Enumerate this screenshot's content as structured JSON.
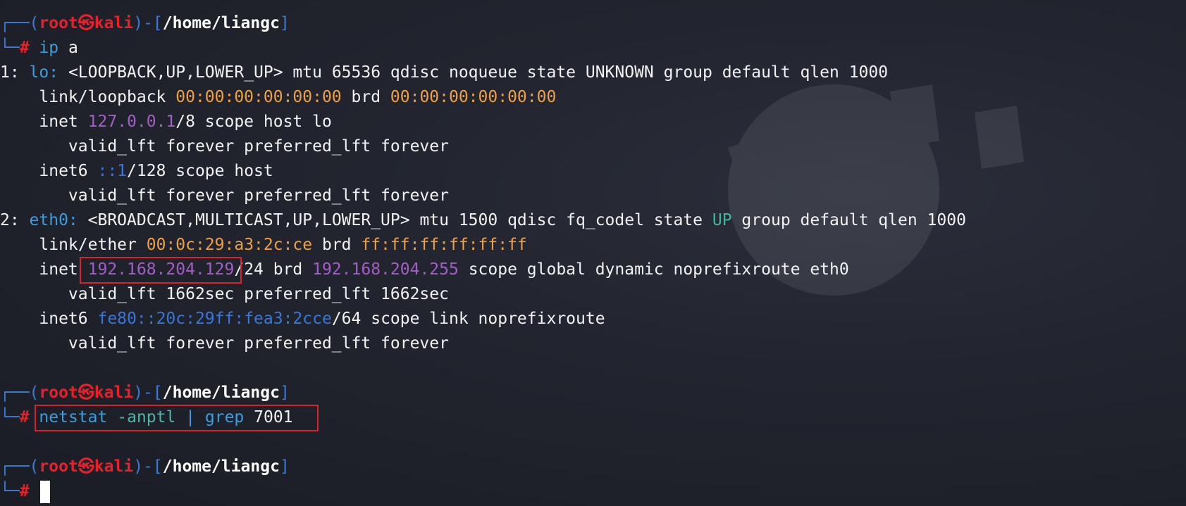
{
  "prompt": {
    "frame_top": "┌──",
    "frame_bottom": "└─",
    "open_paren": "(",
    "user": "root",
    "at_symbol": "㉿",
    "host": "kali",
    "close_paren": ")",
    "dash": "-",
    "open_bracket": "[",
    "path": "/home/liangc",
    "close_bracket": "]",
    "hash": "#"
  },
  "commands": {
    "first": {
      "name": "ip",
      "args": "a"
    },
    "second": {
      "name": "netstat",
      "flag": "-anptl",
      "pipe": "|",
      "grep": "grep",
      "pattern": "7001"
    }
  },
  "output": {
    "lo_index": "1: ",
    "lo_name": "lo:",
    "lo_flags": " <LOOPBACK,UP,LOWER_UP> mtu 65536 qdisc noqueue state UNKNOWN group default qlen 1000",
    "lo_link_label": "    link/loopback ",
    "lo_mac": "00:00:00:00:00:00",
    "lo_brd_label": " brd ",
    "lo_brd": "00:00:00:00:00:00",
    "lo_inet_label": "    inet ",
    "lo_ip": "127.0.0.1",
    "lo_inet_rest": "/8 scope host lo",
    "lo_valid1": "       valid_lft forever preferred_lft forever",
    "lo_inet6_label": "    inet6 ",
    "lo_ip6": "::1",
    "lo_inet6_rest": "/128 scope host",
    "lo_valid2": "       valid_lft forever preferred_lft forever",
    "eth_index": "2: ",
    "eth_name": "eth0:",
    "eth_flags": " <BROADCAST,MULTICAST,UP,LOWER_UP> mtu 1500 qdisc fq_codel state ",
    "eth_state": "UP",
    "eth_flags_rest": " group default qlen 1000",
    "eth_link_label": "    link/ether ",
    "eth_mac": "00:0c:29:a3:2c:ce",
    "eth_brd_label": " brd ",
    "eth_brd_mac": "ff:ff:ff:ff:ff:ff",
    "eth_inet_label": "    inet ",
    "eth_ip": "192.168.204.129",
    "eth_inet_mid": "/24 brd ",
    "eth_brd_ip": "192.168.204.255",
    "eth_inet_rest": " scope global dynamic noprefixroute eth0",
    "eth_valid1": "       valid_lft 1662sec preferred_lft 1662sec",
    "eth_inet6_label": "    inet6 ",
    "eth_ip6": "fe80::20c:29ff:fea3:2cce",
    "eth_inet6_rest": "/64 scope link noprefixroute",
    "eth_valid2": "       valid_lft forever preferred_lft forever"
  },
  "colors": {
    "background": "#22252f",
    "prompt_frame": "#3a7bd5",
    "prompt_user_host": "#e8202a",
    "command": "#3b9ddd",
    "mac": "#f0a040",
    "ipv4": "#a45ec8",
    "ipv6": "#3777d9",
    "highlight_box": "#d6242a"
  }
}
